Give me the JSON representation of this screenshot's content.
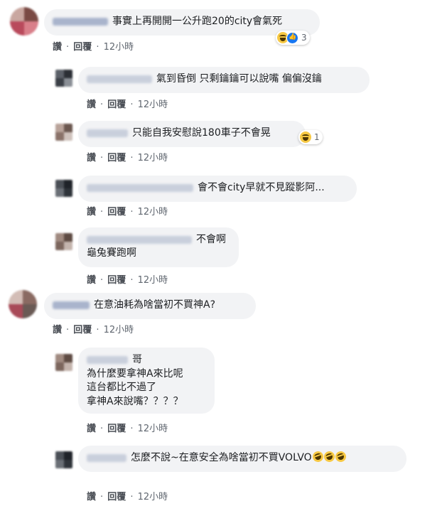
{
  "actions": {
    "like": "讚",
    "reply": "回覆",
    "separator": "·"
  },
  "comments": [
    {
      "text": "事實上再開開一公升跑20的city會氣死",
      "time": "12小時",
      "reaction_count": "3"
    },
    {
      "text": "氣到昏倒 只剩鑰鑰可以說嘴 偏偏沒鑰",
      "time": "12小時"
    },
    {
      "text": "只能自我安慰說180車子不會晃",
      "time": "12小時",
      "reaction_count": "1"
    },
    {
      "text": "會不會city早就不見蹤影阿...",
      "time": "12小時"
    },
    {
      "lines": [
        "不會啊",
        "龜兔賽跑啊"
      ],
      "time": "12小時"
    },
    {
      "text": "在意油耗為啥當初不買神A?",
      "time": "12小時"
    },
    {
      "lines": [
        "哥",
        "為什麼要拿神A來比呢",
        "這台都比不過了",
        "拿神A來說嘴？？？？"
      ],
      "time": "12小時"
    },
    {
      "text": "怎麼不說~在意安全為啥當初不買VOLVO",
      "time": "12小時"
    }
  ],
  "icons": [
    "haha-icon",
    "like-icon",
    "rofl-icon"
  ]
}
